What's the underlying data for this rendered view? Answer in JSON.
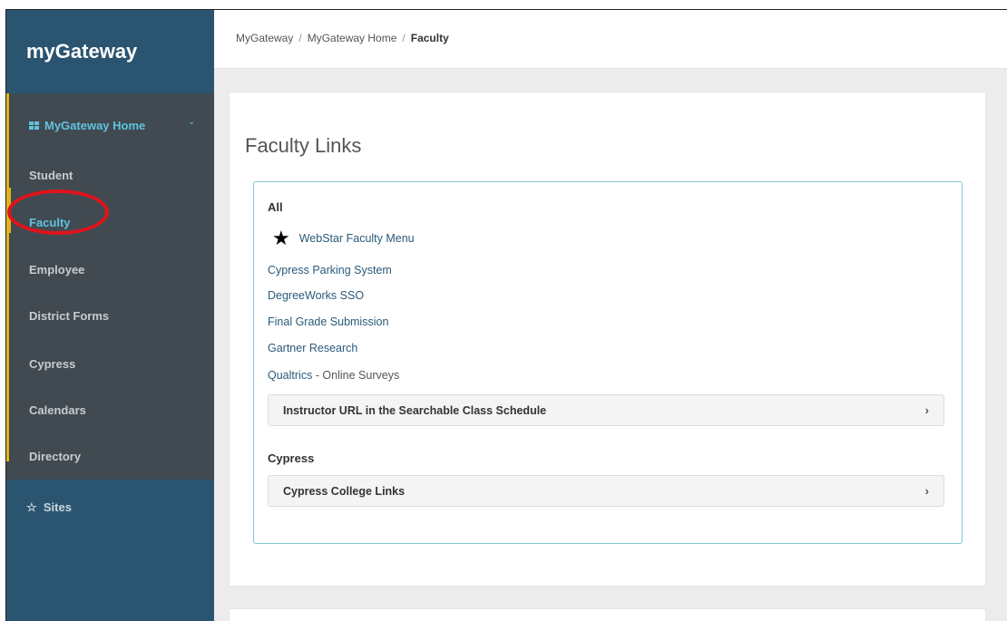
{
  "brand": "myGateway",
  "nav": {
    "home": "MyGateway Home",
    "items": [
      "Student",
      "Faculty",
      "Employee",
      "District Forms",
      "Cypress",
      "Calendars",
      "Directory"
    ],
    "sites": "Sites"
  },
  "breadcrumb": {
    "item1": "MyGateway",
    "sep": "/",
    "item2": "MyGateway Home",
    "current": "Faculty"
  },
  "page_title": "Faculty Links",
  "groups": {
    "all_label": "All",
    "featured_link": "WebStar Faculty Menu",
    "links": [
      "Cypress Parking System",
      "DegreeWorks SSO",
      "Final Grade Submission",
      "Gartner Research"
    ],
    "qualtrics": "Qualtrics",
    "qualtrics_sub": " - Online Surveys",
    "accordion1": "Instructor URL in the Searchable Class Schedule",
    "cypress_label": "Cypress",
    "accordion2": "Cypress College Links"
  },
  "colors": {
    "sidebar": "#2b5470",
    "nav": "#414a51",
    "accent": "#e2b31a",
    "active": "#5fc3dd",
    "highlight_circle": "#e0141c"
  }
}
